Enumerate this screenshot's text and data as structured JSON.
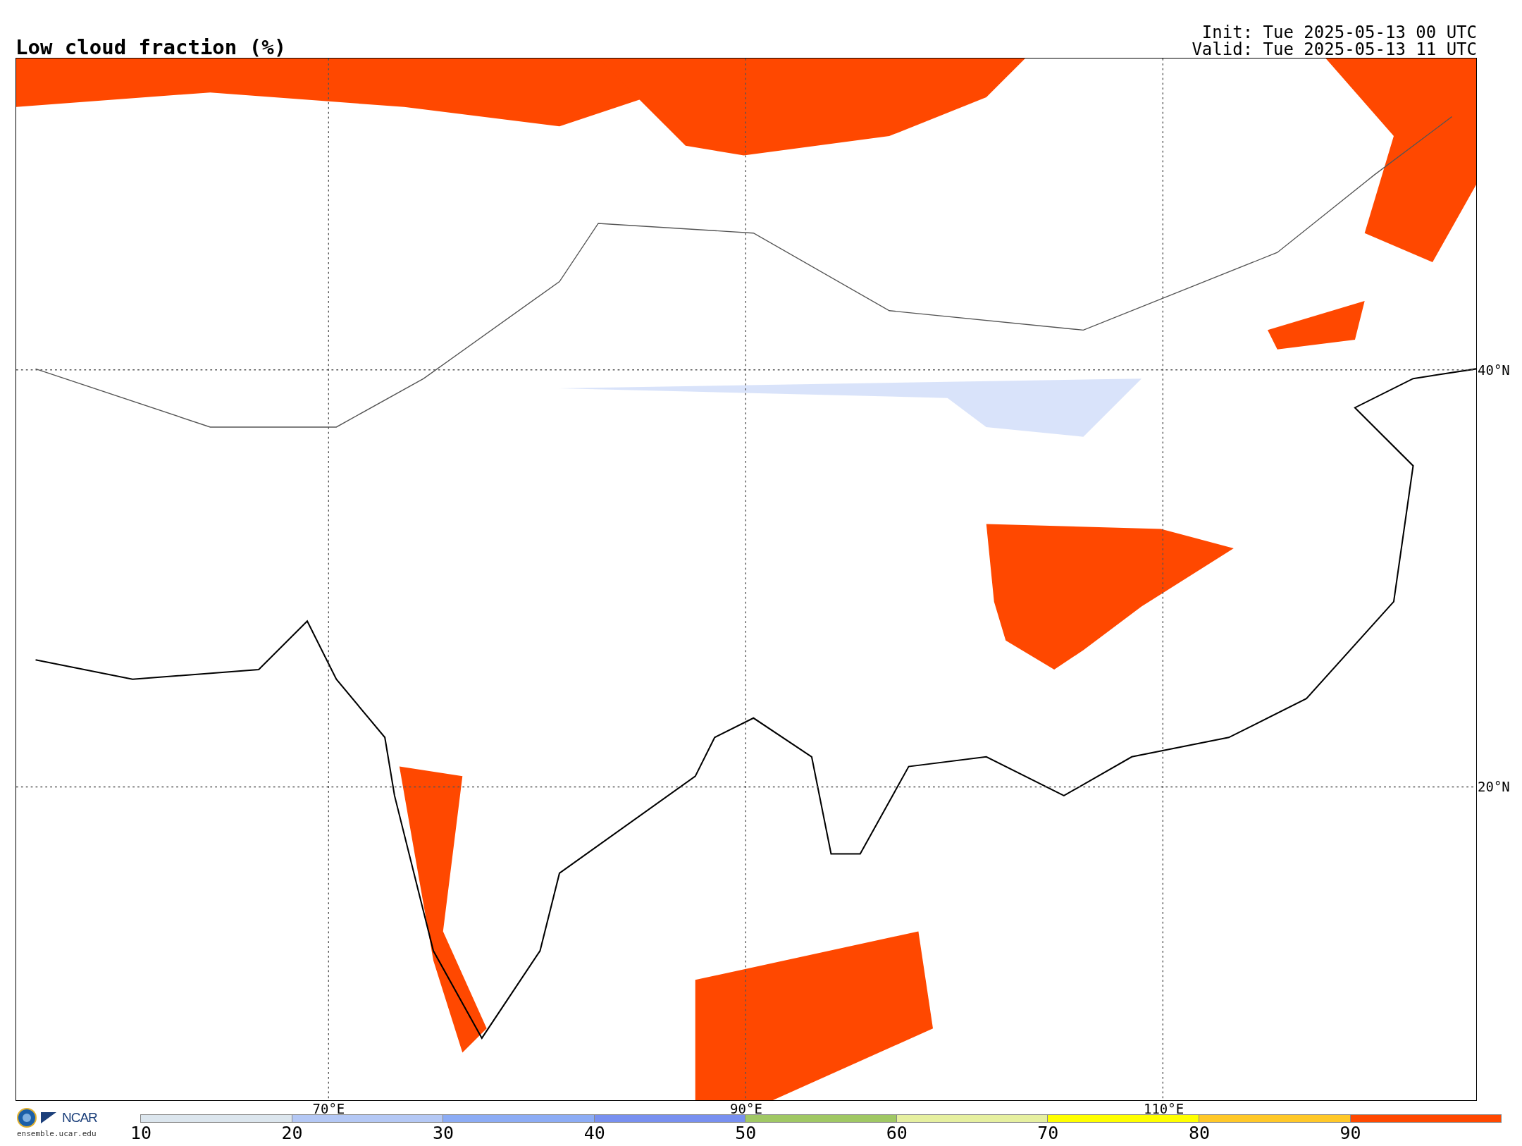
{
  "title": "Low cloud fraction (%)",
  "init": "Init: Tue 2025-05-13 00 UTC",
  "valid": "Valid: Tue 2025-05-13 11 UTC",
  "map": {
    "lon_labels": [
      "70°E",
      "90°E",
      "110°E"
    ],
    "lat_labels": [
      "40°N",
      "20°N"
    ]
  },
  "logo": {
    "org": "NCAR",
    "url": "ensemble.ucar.edu"
  },
  "colorbar": {
    "segments": [
      {
        "label": "10",
        "color": "#dce6ee"
      },
      {
        "label": "20",
        "color": "#b4c8f5"
      },
      {
        "label": "30",
        "color": "#8cacf5"
      },
      {
        "label": "40",
        "color": "#7890f0"
      },
      {
        "label": "50",
        "color": "#a0c864"
      },
      {
        "label": "60",
        "color": "#e6f0a0"
      },
      {
        "label": "70",
        "color": "#ffff00"
      },
      {
        "label": "80",
        "color": "#ffc828"
      },
      {
        "label": "90",
        "color": "#ff4800"
      }
    ]
  }
}
